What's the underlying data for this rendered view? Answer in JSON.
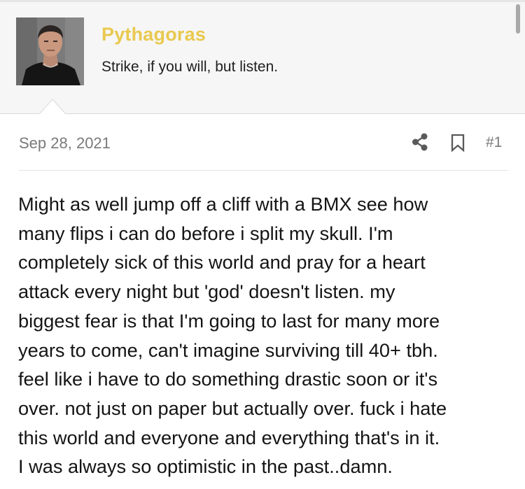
{
  "user": {
    "username": "Pythagoras",
    "custom_title": "Strike, if you will, but listen.",
    "avatar_icon": "user-avatar-photo"
  },
  "post": {
    "date": "Sep 28, 2021",
    "number": "#1",
    "share_icon": "share-icon",
    "bookmark_icon": "bookmark-icon",
    "body": "Might as well jump off a cliff with a BMX see how\nmany flips i can do before i split my skull. I'm\ncompletely sick of this world and pray for a heart\nattack every night but 'god' doesn't listen. my\nbiggest fear is that I'm going to last for many more\nyears to come, can't imagine surviving till 40+ tbh.\nfeel like i have to do something drastic soon or it's\nover. not just on paper but actually over. fuck i hate\nthis world and everyone and everything that's in it.\nI was always so optimistic in the past..damn."
  },
  "colors": {
    "username": "#e9c94f",
    "header_bg": "#f6f6f6",
    "meta_text": "#7a7a7a",
    "icon": "#5a5a5a",
    "body_text": "#141414"
  }
}
